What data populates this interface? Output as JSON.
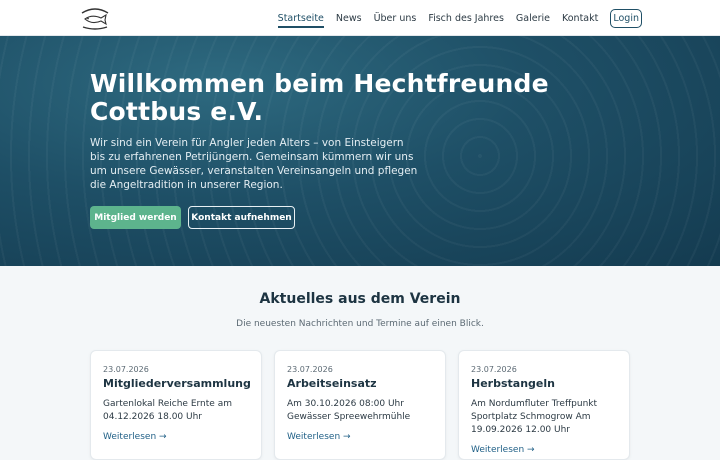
{
  "header": {
    "logo_alt": "Hechtfreunde Cottbus e.V.",
    "nav": [
      {
        "label": "Startseite"
      },
      {
        "label": "News"
      },
      {
        "label": "Über uns"
      },
      {
        "label": "Fisch des Jahres"
      },
      {
        "label": "Galerie"
      },
      {
        "label": "Kontakt"
      },
      {
        "label": "Login"
      }
    ]
  },
  "hero": {
    "title": "Willkommen beim Hechtfreunde Cottbus e.V.",
    "text": "Wir sind ein Verein für Angler jeden Alters – von Einsteigern bis zu erfahrenen Petrijüngern. Gemeinsam kümmern wir uns um unsere Gewässer, veranstalten Vereinsangeln und pflegen die Angeltradition in unserer Region.",
    "primary_button": "Mitglied werden",
    "secondary_button": "Kontakt aufnehmen"
  },
  "news": {
    "title": "Aktuelles aus dem Verein",
    "subtitle": "Die neuesten Nachrichten und Termine auf einen Blick.",
    "cards": [
      {
        "date": "23.07.2026",
        "title": "Mitgliederversammlung",
        "body": "Gartenlokal Reiche Ernte am 04.12.2026 18.00 Uhr",
        "more": "Weiterlesen →"
      },
      {
        "date": "23.07.2026",
        "title": "Arbeitseinsatz",
        "body": "Am 30.10.2026 08:00 Uhr Gewässer Spreewehrmühle",
        "more": "Weiterlesen →"
      },
      {
        "date": "23.07.2026",
        "title": "Herbstangeln",
        "body": "Am Nordumfluter Treffpunkt Sportplatz Schmogrow Am 19.09.2026 12.00 Uhr",
        "more": "Weiterlesen →"
      }
    ]
  }
}
